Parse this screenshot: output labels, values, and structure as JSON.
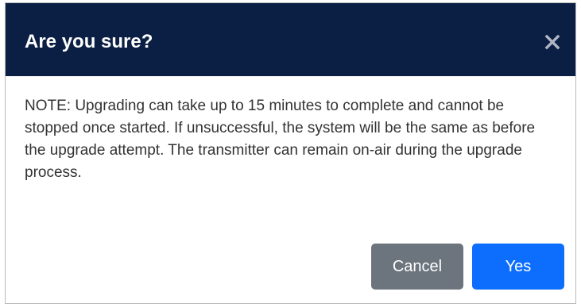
{
  "dialog": {
    "title": "Are you sure?",
    "close_icon": "close-icon",
    "message": "NOTE: Upgrading can take up to 15 minutes to complete and cannot be stopped once started. If unsuccessful, the system will be the same as before the upgrade attempt. The transmitter can remain on-air during the upgrade process.",
    "buttons": {
      "cancel_label": "Cancel",
      "yes_label": "Yes"
    }
  },
  "colors": {
    "header_bg": "#0b1f44",
    "header_text": "#ffffff",
    "body_text": "#333333",
    "cancel_bg": "#6c757d",
    "yes_bg": "#0d6efd"
  }
}
